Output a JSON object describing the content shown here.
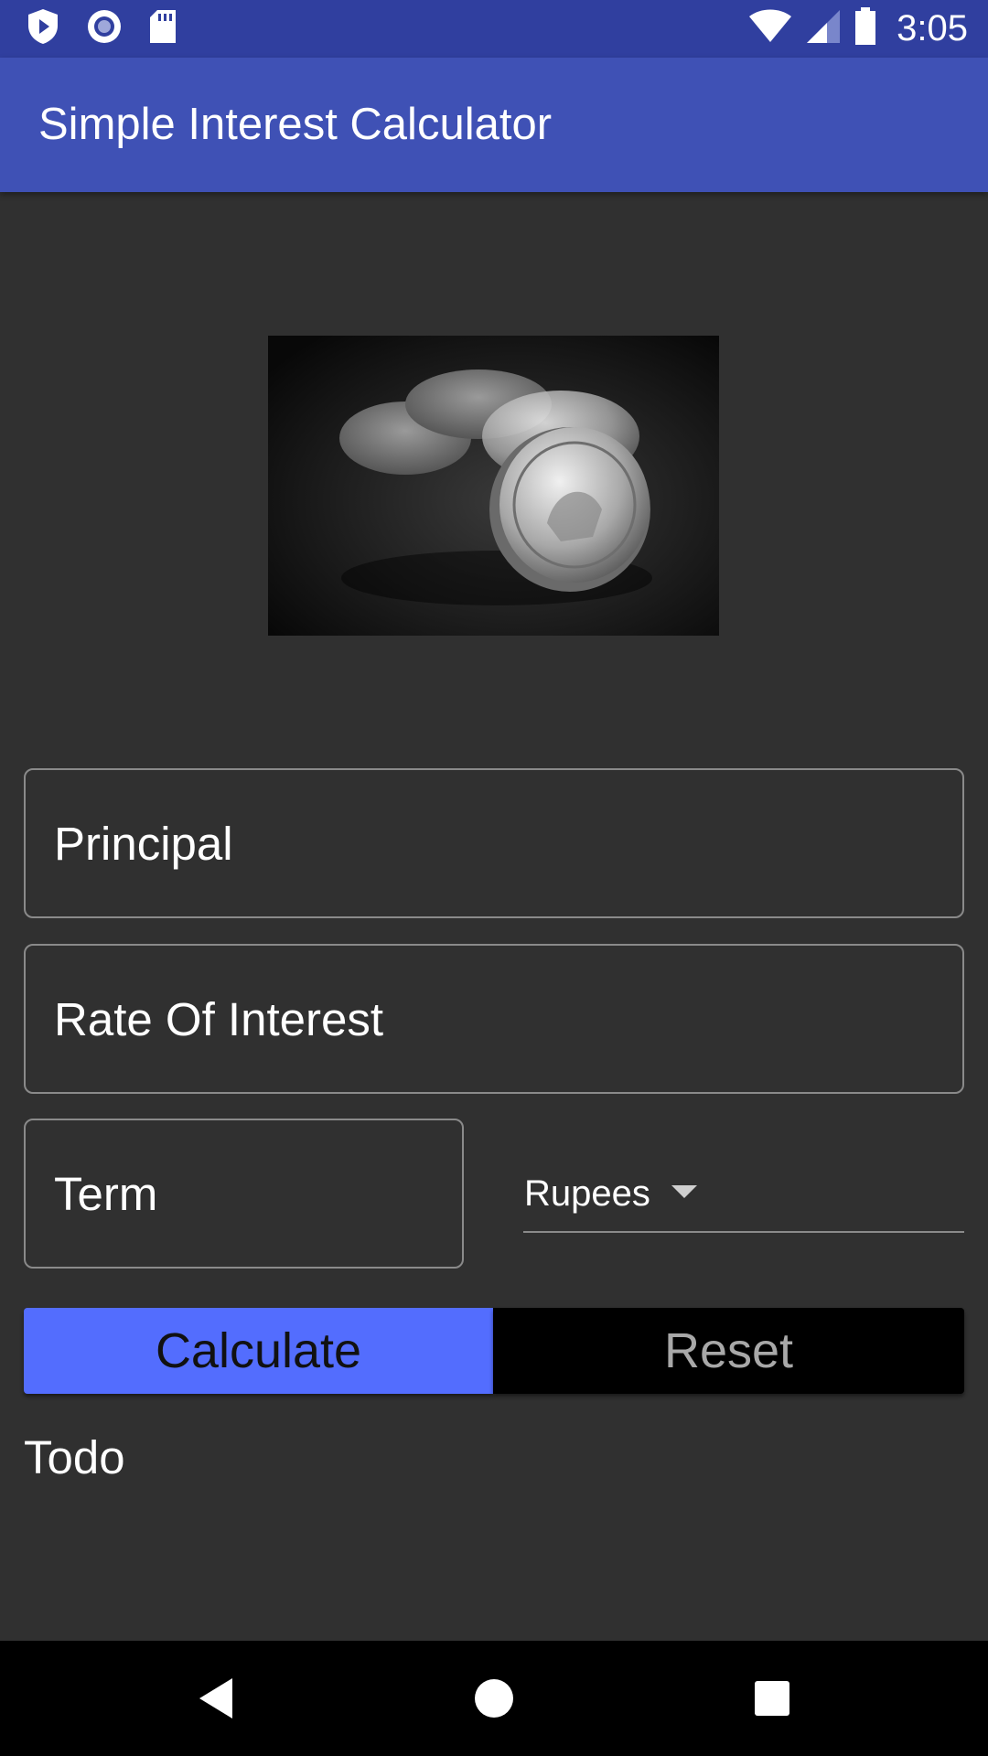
{
  "status_bar": {
    "time": "3:05",
    "left_icons": [
      "play-protect-icon",
      "circle-notification-icon",
      "sd-card-icon"
    ],
    "right_icons": [
      "wifi-icon",
      "cell-signal-icon",
      "battery-icon"
    ],
    "background": "#303F9F"
  },
  "app_bar": {
    "title": "Simple Interest Calculator",
    "background": "#3F51B5"
  },
  "hero": {
    "icon": "coins-photo"
  },
  "form": {
    "principal_label": "Principal",
    "rate_label": "Rate Of Interest",
    "term_label": "Term",
    "currency_selected": "Rupees"
  },
  "buttons": {
    "calculate_label": "Calculate",
    "reset_label": "Reset",
    "accent": "#536DFE"
  },
  "result": {
    "text": "Todo"
  },
  "nav_bar": {
    "icons": [
      "back-icon",
      "home-icon",
      "recents-icon"
    ]
  }
}
